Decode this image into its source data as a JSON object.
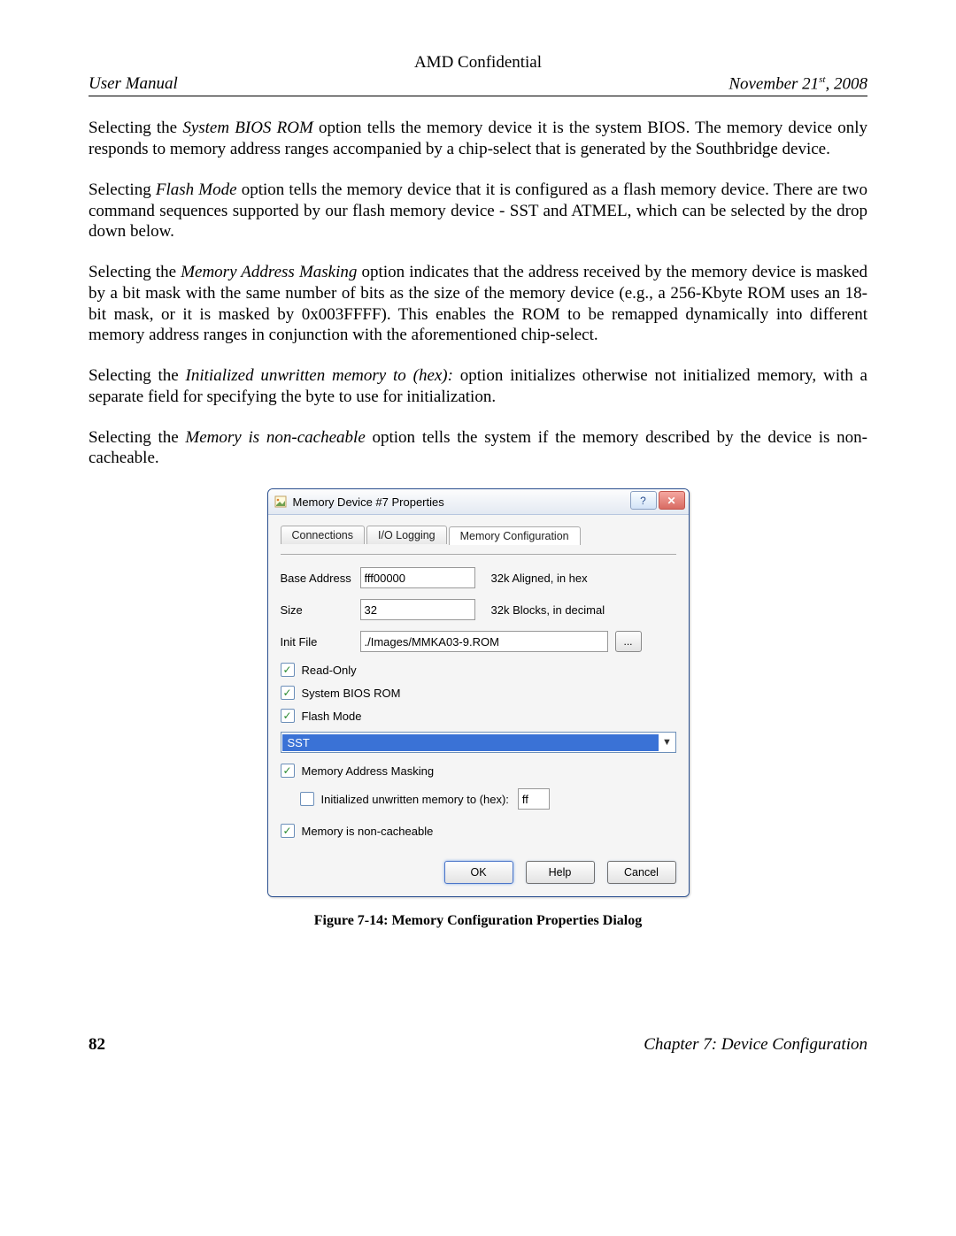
{
  "header": {
    "confidential": "AMD Confidential",
    "left": "User Manual",
    "date_prefix": "November 21",
    "date_sup": "st",
    "date_suffix": ", 2008"
  },
  "paragraphs": {
    "p1a": "Selecting the ",
    "p1i": "System BIOS ROM",
    "p1b": " option tells the memory device it is the system BIOS. The memory device only responds to memory address ranges accompanied by a chip-select that is generated by the Southbridge device.",
    "p2a": "Selecting ",
    "p2i": "Flash Mode",
    "p2b": " option tells the memory device that it is configured as a flash memory device. There are two command sequences supported by our flash memory device - SST and ATMEL, which can be selected by the drop down below.",
    "p3a": "Selecting the ",
    "p3i": "Memory Address Masking",
    "p3b": " option indicates that the address received by the memory device is masked by a bit mask with the same number of bits as the size of the memory device (e.g., a 256-Kbyte ROM uses an 18-bit mask, or it is masked by 0x003FFFF). This enables the ROM to be remapped dynamically into different memory address ranges in conjunction with the aforementioned chip-select.",
    "p4a": "Selecting the ",
    "p4i": "Initialized unwritten memory to (hex):",
    "p4b": " option initializes otherwise not initialized memory, with a separate field for specifying the byte to use for initialization.",
    "p5a": "Selecting the ",
    "p5i": "Memory is non-cacheable",
    "p5b": " option tells the system if the memory described by the device is non-cacheable."
  },
  "dialog": {
    "title": "Memory Device #7 Properties",
    "tabs": {
      "t1": "Connections",
      "t2": "I/O Logging",
      "t3": "Memory Configuration"
    },
    "labels": {
      "base_address": "Base Address",
      "size": "Size",
      "init_file": "Init File",
      "hint_addr": "32k Aligned, in hex",
      "hint_size": "32k Blocks, in decimal"
    },
    "values": {
      "base_address": "fff00000",
      "size": "32",
      "init_file": "./Images/MMKA03-9.ROM",
      "dropdown": "SST",
      "hex_byte": "ff"
    },
    "checks": {
      "read_only": "Read-Only",
      "system_bios": "System BIOS ROM",
      "flash_mode": "Flash Mode",
      "mem_mask": "Memory Address Masking",
      "init_hex": "Initialized unwritten memory to (hex):",
      "non_cache": "Memory is non-cacheable"
    },
    "buttons": {
      "ok": "OK",
      "help": "Help",
      "cancel": "Cancel",
      "browse": "..."
    }
  },
  "caption": "Figure 7-14: Memory Configuration Properties Dialog",
  "footer": {
    "page": "82",
    "chapter": "Chapter 7: Device Configuration"
  }
}
